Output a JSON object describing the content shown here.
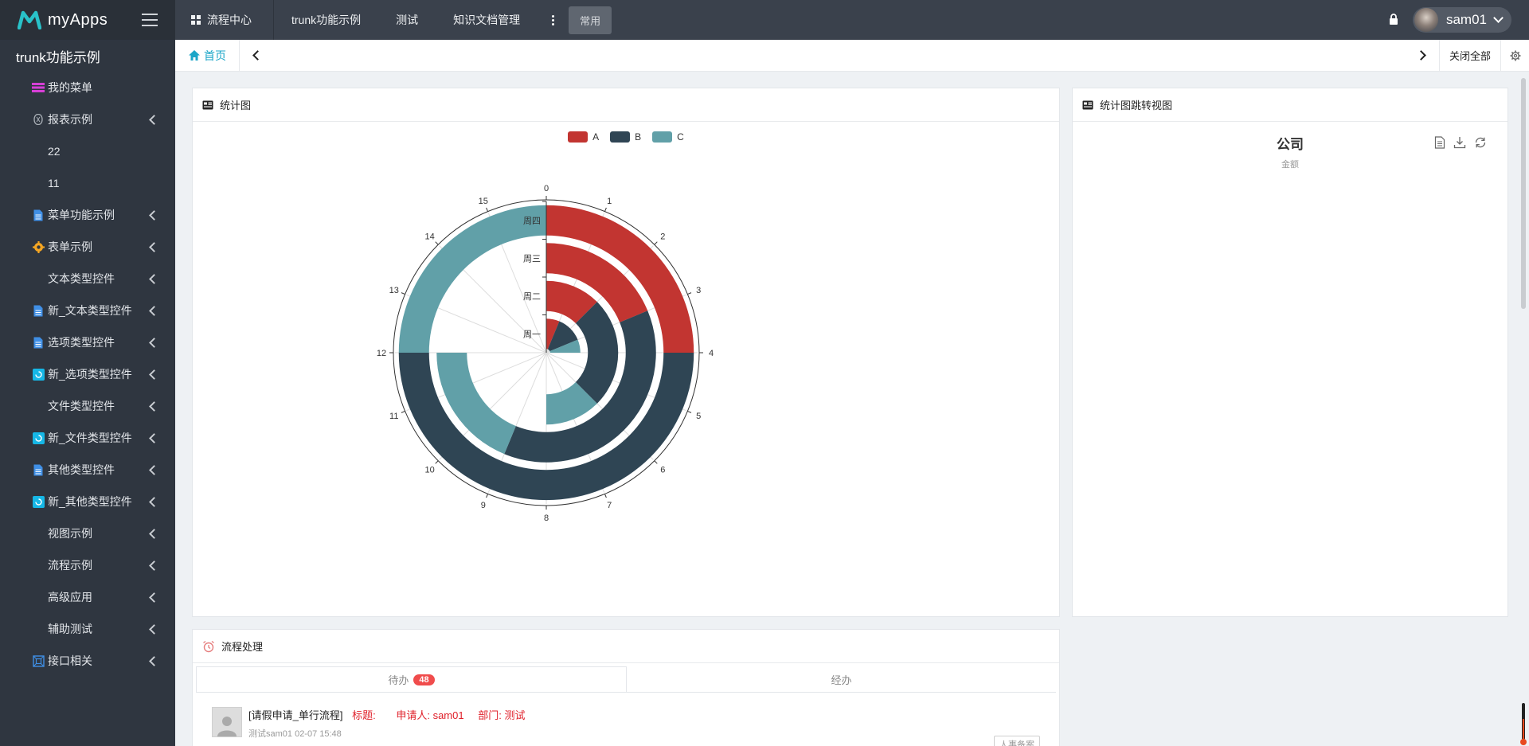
{
  "brand": {
    "name": "myApps"
  },
  "sidebar": {
    "title": "trunk功能示例",
    "items": [
      {
        "label": "我的菜单",
        "icon": "magenta-menu-icon",
        "arrow": false,
        "sub": false
      },
      {
        "label": "报表示例",
        "icon": "gear-small-icon",
        "arrow": true,
        "sub": false
      },
      {
        "label": "22",
        "icon": "",
        "arrow": false,
        "sub": true
      },
      {
        "label": "11",
        "icon": "",
        "arrow": false,
        "sub": true
      },
      {
        "label": "菜单功能示例",
        "icon": "document-icon",
        "arrow": true,
        "sub": false
      },
      {
        "label": "表单示例",
        "icon": "gear-orange-icon",
        "arrow": true,
        "sub": false
      },
      {
        "label": "文本类型控件",
        "icon": "",
        "arrow": true,
        "sub": true
      },
      {
        "label": "新_文本类型控件",
        "icon": "document-icon",
        "arrow": true,
        "sub": false
      },
      {
        "label": "选项类型控件",
        "icon": "document-icon",
        "arrow": true,
        "sub": false
      },
      {
        "label": "新_选项类型控件",
        "icon": "cyan-box-icon",
        "arrow": true,
        "sub": false
      },
      {
        "label": "文件类型控件",
        "icon": "",
        "arrow": true,
        "sub": true
      },
      {
        "label": "新_文件类型控件",
        "icon": "cyan-box-icon",
        "arrow": true,
        "sub": false
      },
      {
        "label": "其他类型控件",
        "icon": "document-icon",
        "arrow": true,
        "sub": false
      },
      {
        "label": "新_其他类型控件",
        "icon": "cyan-box-icon",
        "arrow": true,
        "sub": false
      },
      {
        "label": "视图示例",
        "icon": "",
        "arrow": true,
        "sub": true
      },
      {
        "label": "流程示例",
        "icon": "",
        "arrow": true,
        "sub": true
      },
      {
        "label": "高级应用",
        "icon": "",
        "arrow": true,
        "sub": true
      },
      {
        "label": "辅助测试",
        "icon": "",
        "arrow": true,
        "sub": true
      },
      {
        "label": "接口相关",
        "icon": "api-icon",
        "arrow": true,
        "sub": false
      }
    ]
  },
  "topbar": {
    "nav": [
      "流程中心",
      "trunk功能示例",
      "测试",
      "知识文档管理"
    ],
    "common": "常用",
    "user": "sam01"
  },
  "tabbar": {
    "home": "首页",
    "close_all": "关闭全部"
  },
  "panels": {
    "chart": {
      "title": "统计图"
    },
    "chart_jump": {
      "title": "统计图跳转视图",
      "chart_title": "公司",
      "chart_subtitle": "金额"
    },
    "flow": {
      "title": "流程处理",
      "tab_todo": "待办",
      "todo_count": "48",
      "tab_done": "经办",
      "item": {
        "name": "[请假申请_单行流程]",
        "title_label": "标题:",
        "applicant": "申请人: sam01",
        "dept": "部门: 测试",
        "meta": "测试sam01  02-07 15:48",
        "tag": "人事备案"
      }
    }
  },
  "colors": {
    "A": "#c23531",
    "B": "#2f4554",
    "C": "#61a0a8"
  },
  "chart_data": {
    "type": "polar-stacked-bar",
    "legend": [
      "A",
      "B",
      "C"
    ],
    "categories": [
      "周一",
      "周二",
      "周三",
      "周四"
    ],
    "angle_ticks": [
      "0",
      "1",
      "2",
      "3",
      "4",
      "5",
      "6",
      "7",
      "8",
      "9",
      "10",
      "11",
      "12",
      "13",
      "14",
      "15"
    ],
    "angle_max": 16,
    "series": [
      {
        "name": "A",
        "values": [
          1,
          2,
          3,
          4
        ]
      },
      {
        "name": "B",
        "values": [
          2,
          4,
          6,
          8
        ]
      },
      {
        "name": "C",
        "values": [
          1,
          2,
          3,
          4
        ]
      }
    ]
  }
}
